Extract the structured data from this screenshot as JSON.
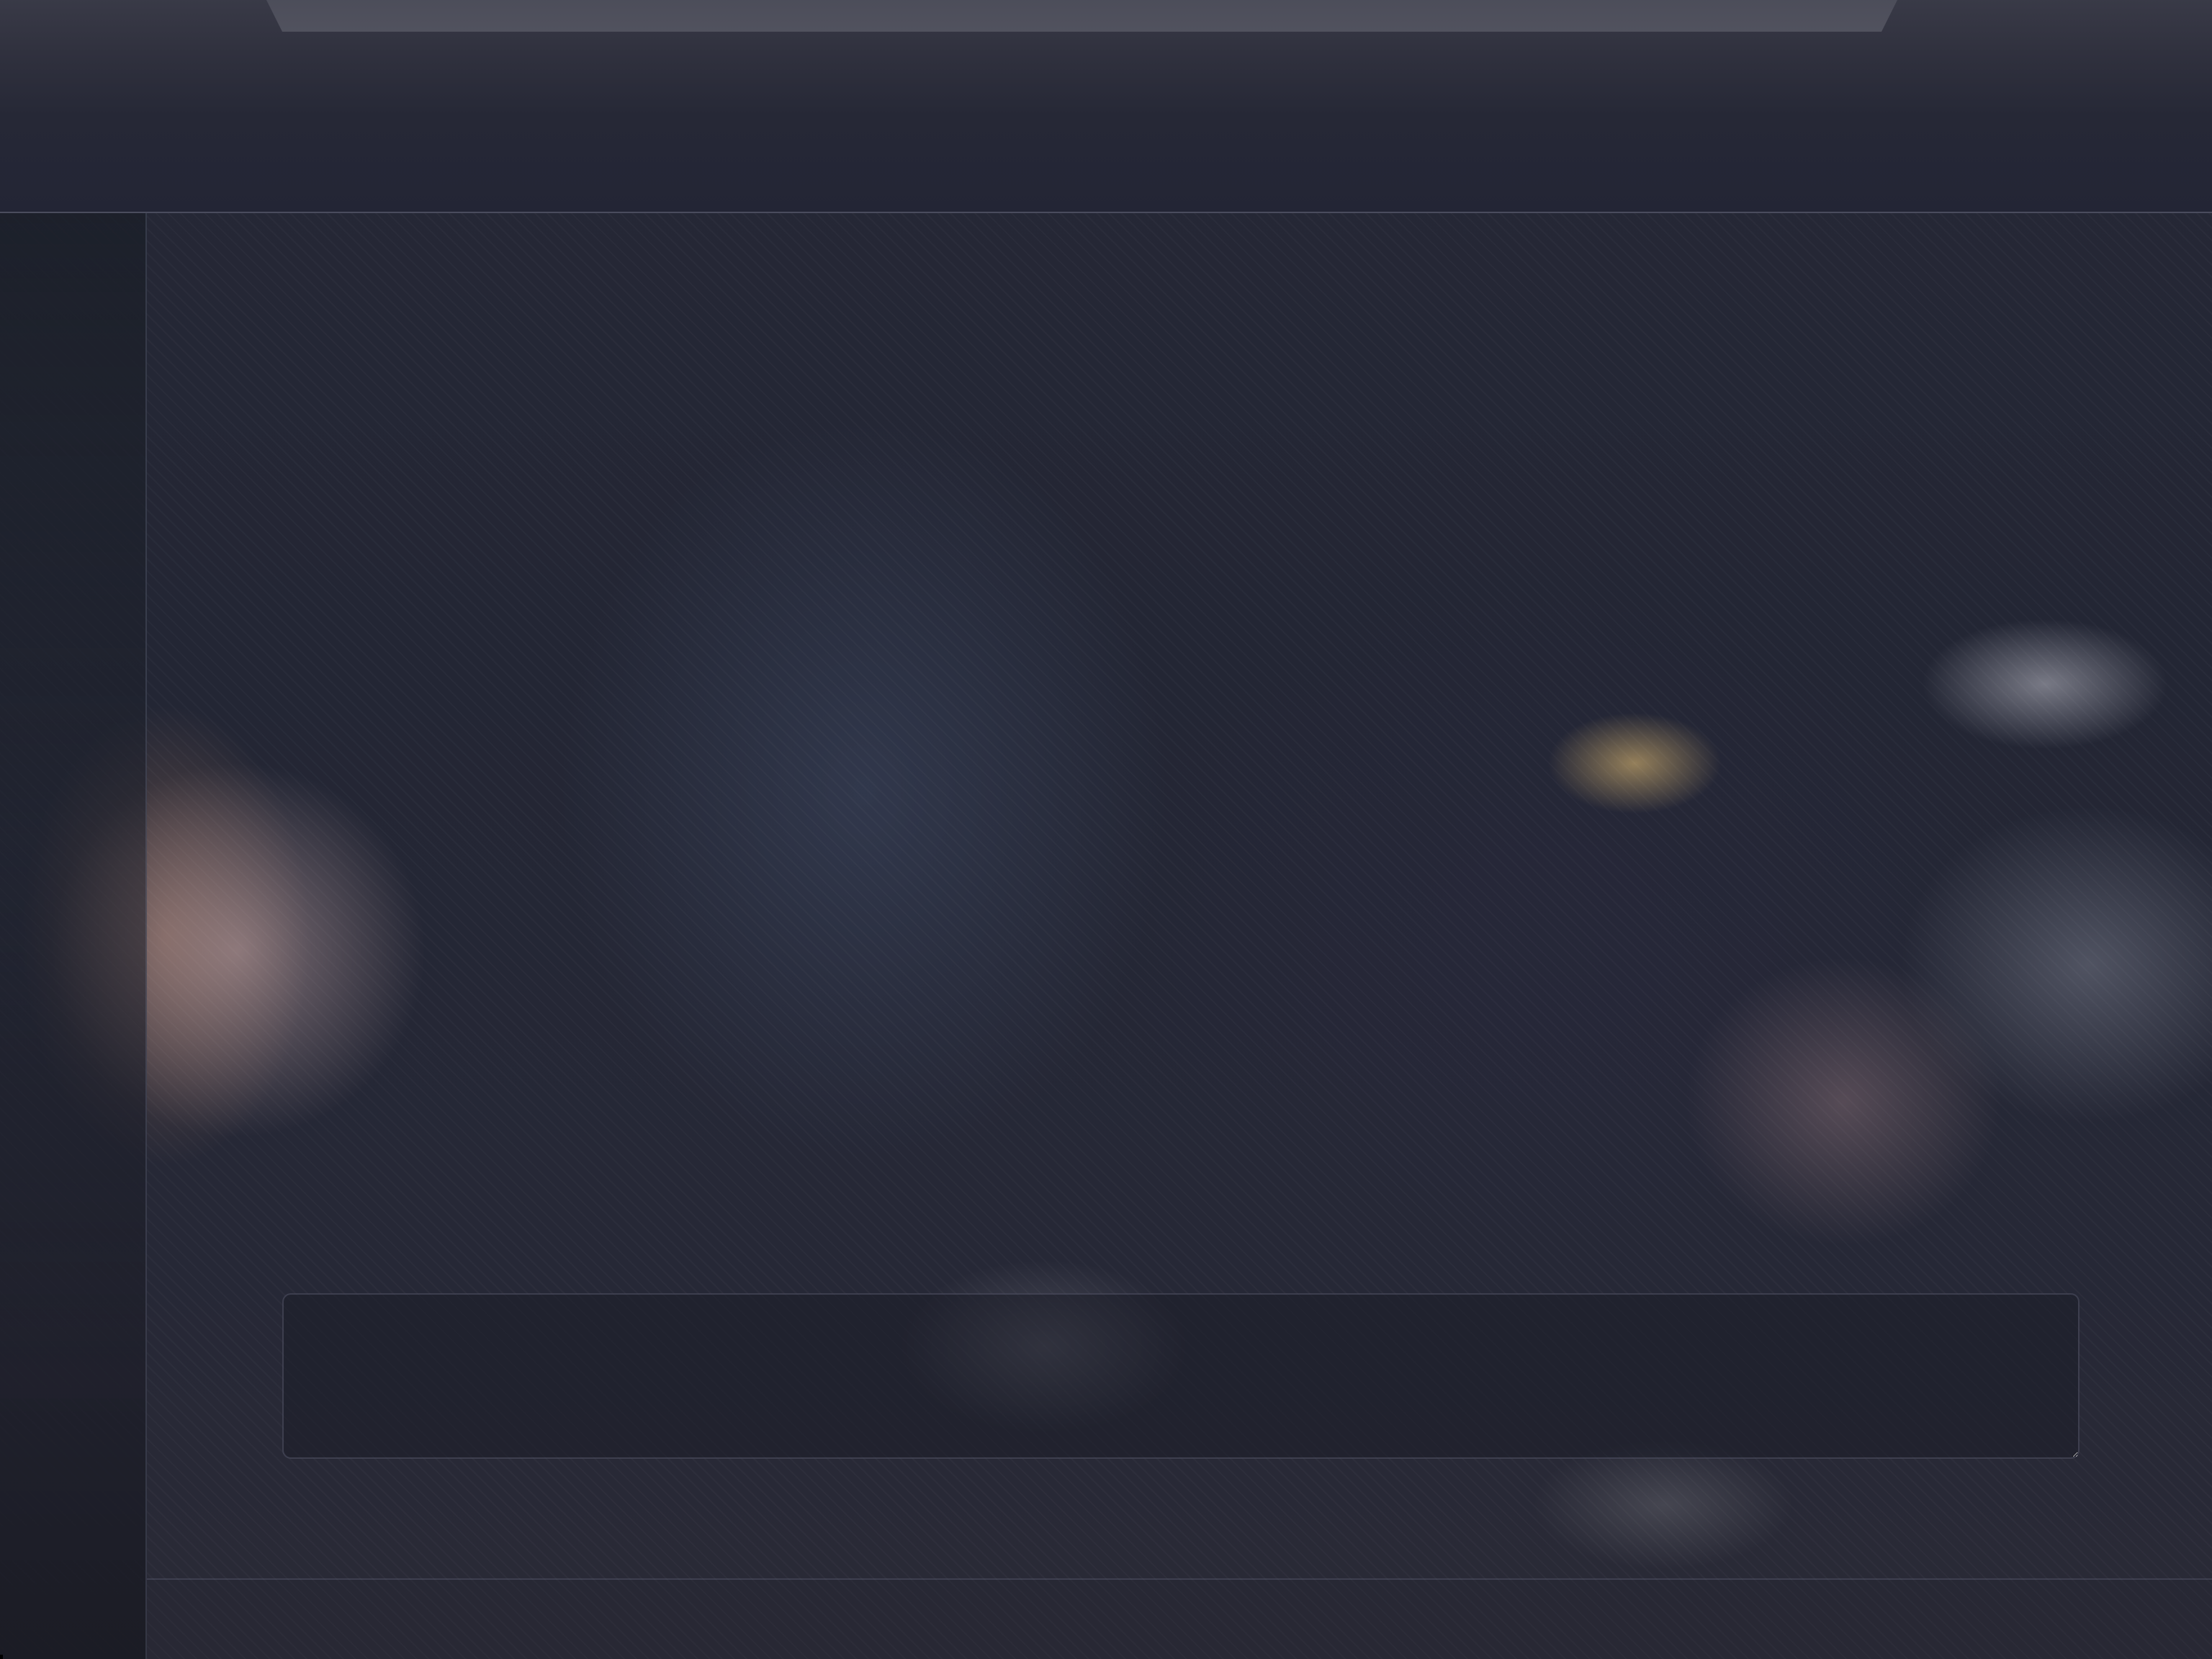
{
  "window": {
    "title": ""
  },
  "composer": {
    "value": "",
    "placeholder": ""
  },
  "colors": {
    "background": "#222431",
    "header_top": "#393a47",
    "border": "#787d96",
    "tab": "#4f505c"
  }
}
